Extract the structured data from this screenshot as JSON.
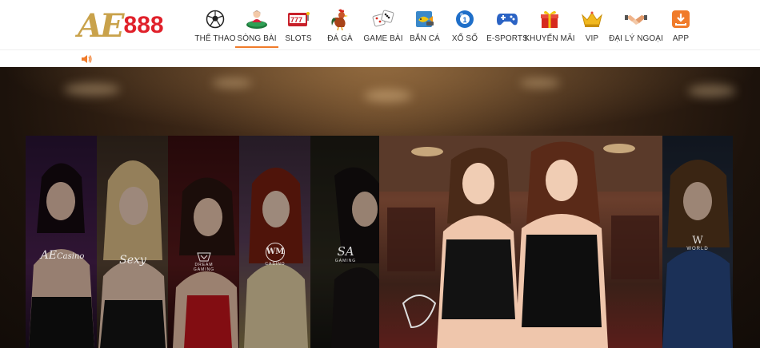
{
  "brand": {
    "logo_text": "AE",
    "logo_num": "888"
  },
  "nav": {
    "items": [
      {
        "label": "THỂ THAO",
        "icon": "soccer-ball-icon"
      },
      {
        "label": "SÒNG BÀI",
        "icon": "casino-dealer-icon",
        "active": true
      },
      {
        "label": "SLOTS",
        "icon": "slot-machine-icon"
      },
      {
        "label": "ĐÁ GÀ",
        "icon": "rooster-icon"
      },
      {
        "label": "GAME BÀI",
        "icon": "dice-icon"
      },
      {
        "label": "BẮN CÁ",
        "icon": "fish-shooting-icon"
      },
      {
        "label": "XỔ SỐ",
        "icon": "lottery-ball-icon"
      },
      {
        "label": "E-SPORTS",
        "icon": "gamepad-icon"
      },
      {
        "label": "KHUYẾN MÃI",
        "icon": "gift-icon"
      },
      {
        "label": "VIP",
        "icon": "crown-icon"
      },
      {
        "label": "ĐẠI LÝ NGOẠI",
        "icon": "handshake-icon"
      },
      {
        "label": "APP",
        "icon": "download-icon"
      }
    ]
  },
  "subbar": {
    "icon": "speaker-icon"
  },
  "hero": {
    "providers": [
      {
        "logo": "AE",
        "name": "Casino"
      },
      {
        "logo": "Sexy",
        "name": ""
      },
      {
        "logo": "",
        "name": "DREAM GAMING"
      },
      {
        "logo": "WM",
        "name": "CASINO"
      },
      {
        "logo": "SA",
        "name": "GAMING"
      },
      {
        "logo": "",
        "name": ""
      },
      {
        "logo": "W",
        "name": "WORLD"
      }
    ],
    "colors": {
      "accent": "#f07b2a",
      "logo_gold": "#c9a24b",
      "logo_red": "#e0202a"
    }
  }
}
